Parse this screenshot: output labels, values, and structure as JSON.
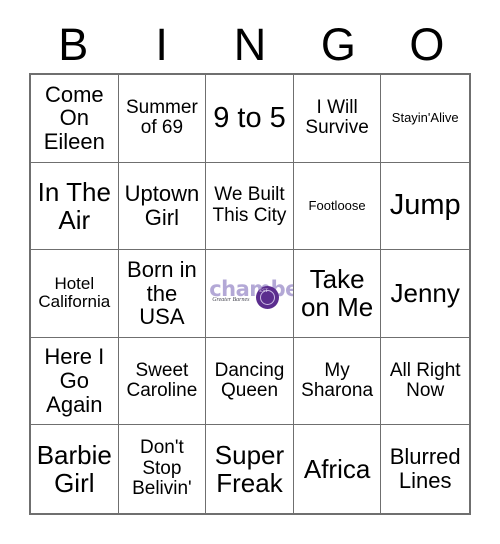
{
  "card": {
    "header_letters": [
      "B",
      "I",
      "N",
      "G",
      "O"
    ],
    "rows": [
      [
        {
          "text": "Come On Eileen",
          "size": "lg"
        },
        {
          "text": "Summer of 69",
          "size": "md"
        },
        {
          "text": "9 to 5",
          "size": "xxl"
        },
        {
          "text": "I Will Survive",
          "size": "md"
        },
        {
          "text": "Stayin'Alive",
          "size": "xs"
        }
      ],
      [
        {
          "text": "In The Air",
          "size": "xl"
        },
        {
          "text": "Uptown Girl",
          "size": "lg"
        },
        {
          "text": "We Built This City",
          "size": "md"
        },
        {
          "text": "Footloose",
          "size": "xs"
        },
        {
          "text": "Jump",
          "size": "xxl"
        }
      ],
      [
        {
          "text": "Hotel California",
          "size": "sm"
        },
        {
          "text": "Born in the USA",
          "size": "lg"
        },
        {
          "text": "",
          "size": "md",
          "free_space": true
        },
        {
          "text": "Take on Me",
          "size": "xl"
        },
        {
          "text": "Jenny",
          "size": "xl"
        }
      ],
      [
        {
          "text": "Here I Go Again",
          "size": "lg"
        },
        {
          "text": "Sweet Caroline",
          "size": "md"
        },
        {
          "text": "Dancing Queen",
          "size": "md"
        },
        {
          "text": "My Sharona",
          "size": "md"
        },
        {
          "text": "All Right Now",
          "size": "md"
        }
      ],
      [
        {
          "text": "Barbie Girl",
          "size": "xl"
        },
        {
          "text": "Don't Stop Belivin'",
          "size": "md"
        },
        {
          "text": "Super Freak",
          "size": "xl"
        },
        {
          "text": "Africa",
          "size": "xl"
        },
        {
          "text": "Blurred Lines",
          "size": "lg"
        }
      ]
    ],
    "free_space_logo": {
      "word": "chamber",
      "tagline": "Greater Barnes",
      "seal_mark": "EST",
      "word_color": "#b3a8d6",
      "seal_color": "#5b2d8e"
    },
    "colors": {
      "background": "#ffffff",
      "grid_line": "#6f6f6f",
      "text": "#000000"
    }
  }
}
